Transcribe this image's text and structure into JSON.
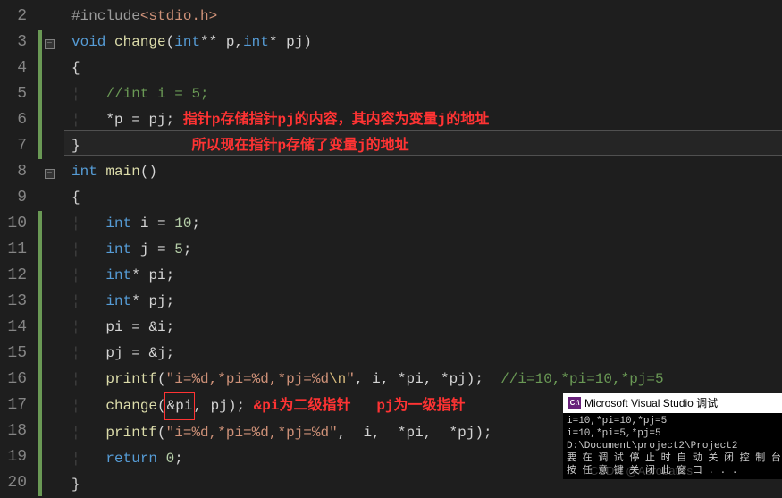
{
  "lines": [
    {
      "num": 2,
      "bar": "",
      "fold": "",
      "html": "<span class='pp'>#include</span><span class='str'>&lt;stdio.h&gt;</span>"
    },
    {
      "num": 3,
      "bar": "green",
      "fold": "−",
      "html": "<span class='kw'>void</span> <span class='fn'>change</span><span class='punc'>(</span><span class='kw'>int</span><span class='op'>**</span> p<span class='punc'>,</span><span class='kw'>int</span><span class='op'>*</span> pj<span class='punc'>)</span>"
    },
    {
      "num": 4,
      "bar": "green",
      "fold": "",
      "html": "<span class='punc'>{</span>"
    },
    {
      "num": 5,
      "bar": "green",
      "fold": "",
      "html": "<span class='guide'>¦</span>   <span class='cmt'>//int i = 5;</span>"
    },
    {
      "num": 6,
      "bar": "green",
      "fold": "",
      "html": "<span class='guide'>¦</span>   <span class='op'>*</span>p <span class='op'>=</span> pj<span class='punc'>;</span> <span class='annot'>指针p存储指针pj的内容，其内容为变量j的地址</span>"
    },
    {
      "num": 7,
      "bar": "green",
      "fold": "",
      "hl": true,
      "html": "<span class='punc'>}</span>             <span class='annot'>所以现在指针p存储了变量j的地址</span>"
    },
    {
      "num": 8,
      "bar": "",
      "fold": "−",
      "html": "<span class='kw'>int</span> <span class='fn'>main</span><span class='punc'>()</span>"
    },
    {
      "num": 9,
      "bar": "",
      "fold": "",
      "html": "<span class='punc'>{</span>"
    },
    {
      "num": 10,
      "bar": "green",
      "fold": "",
      "html": "<span class='guide'>¦</span>   <span class='kw'>int</span> i <span class='op'>=</span> <span class='num'>10</span><span class='punc'>;</span>"
    },
    {
      "num": 11,
      "bar": "green",
      "fold": "",
      "html": "<span class='guide'>¦</span>   <span class='kw'>int</span> j <span class='op'>=</span> <span class='num'>5</span><span class='punc'>;</span>"
    },
    {
      "num": 12,
      "bar": "green",
      "fold": "",
      "html": "<span class='guide'>¦</span>   <span class='kw'>int</span><span class='op'>*</span> pi<span class='punc'>;</span>"
    },
    {
      "num": 13,
      "bar": "green",
      "fold": "",
      "html": "<span class='guide'>¦</span>   <span class='kw'>int</span><span class='op'>*</span> pj<span class='punc'>;</span>"
    },
    {
      "num": 14,
      "bar": "green",
      "fold": "",
      "html": "<span class='guide'>¦</span>   pi <span class='op'>=</span> <span class='op'>&amp;</span>i<span class='punc'>;</span>"
    },
    {
      "num": 15,
      "bar": "green",
      "fold": "",
      "html": "<span class='guide'>¦</span>   pj <span class='op'>=</span> <span class='op'>&amp;</span>j<span class='punc'>;</span>"
    },
    {
      "num": 16,
      "bar": "green",
      "fold": "",
      "html": "<span class='guide'>¦</span>   <span class='fn'>printf</span><span class='punc'>(</span><span class='str'>\"i=%d,*pi=%d,*pj=%d<span class='esc'>\\n</span>\"</span><span class='punc'>,</span> i<span class='punc'>,</span> <span class='op'>*</span>pi<span class='punc'>,</span> <span class='op'>*</span>pj<span class='punc'>)</span><span class='punc'>;</span>  <span class='cmt'>//i=10,*pi=10,*pj=5</span>"
    },
    {
      "num": 17,
      "bar": "green",
      "fold": "",
      "html": "<span class='guide'>¦</span>   <span class='fn'>change</span><span class='punc'>(</span><span class='boxed red-box'><span class='op'>&amp;</span>pi</span><span class='punc'>,</span> pj<span class='punc'>)</span><span class='punc'>;</span> <span class='annot'>&amp;pi为二级指针   pj为一级指针</span>"
    },
    {
      "num": 18,
      "bar": "green",
      "fold": "",
      "html": "<span class='guide'>¦</span>   <span class='fn'>printf</span><span class='punc'>(</span><span class='str'>\"i=%d,*pi=%d,*pj=%d\"</span><span class='punc'>,</span>  i<span class='punc'>,</span>  <span class='op'>*</span>pi<span class='punc'>,</span>  <span class='op'>*</span>pj<span class='punc'>)</span><span class='punc'>;</span>"
    },
    {
      "num": 19,
      "bar": "green",
      "fold": "",
      "html": "<span class='guide'>¦</span>   <span class='kw'>return</span> <span class='num'>0</span><span class='punc'>;</span>"
    },
    {
      "num": 20,
      "bar": "green",
      "fold": "",
      "html": "<span class='punc'>}</span>"
    }
  ],
  "popup": {
    "title": "Microsoft Visual Studio 调试",
    "icon": "C:\\",
    "body": "i=10,*pi=10,*pj=5\ni=10,*pi=5,*pj=5\nD:\\Document\\project2\\Project2\n要 在 调 试 停 止 时 自 动 关 闭 控 制 台 ，\n按 任 意 键 关 闭 此 窗 口 . . ."
  },
  "watermark": "CSDN @Aerobatics"
}
